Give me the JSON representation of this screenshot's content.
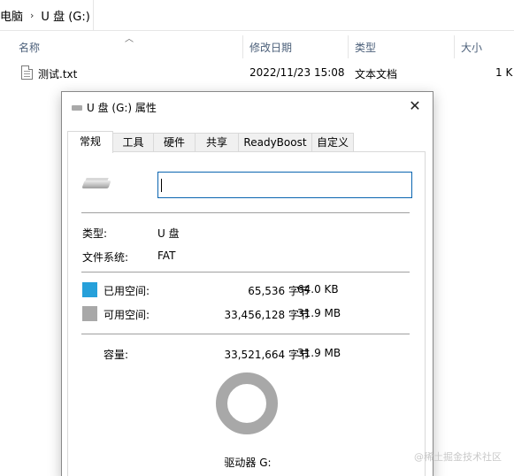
{
  "breadcrumb": {
    "pc": "电脑",
    "drive": "U 盘 (G:)",
    "separator": "›"
  },
  "columns": {
    "name": "名称",
    "modified": "修改日期",
    "type": "类型",
    "size": "大小"
  },
  "files": [
    {
      "name": "测试.txt",
      "modified": "2022/11/23 15:08",
      "type": "文本文档",
      "size": "1 K"
    }
  ],
  "dialog": {
    "title": "U 盘 (G:) 属性",
    "close_glyph": "✕",
    "tabs": [
      "常规",
      "工具",
      "硬件",
      "共享",
      "ReadyBoost",
      "自定义"
    ],
    "active_tab": "常规",
    "name_value": "",
    "type_label": "类型:",
    "type_value": "U 盘",
    "fs_label": "文件系统:",
    "fs_value": "FAT",
    "used_label": "已用空间:",
    "used_bytes": "65,536 字节",
    "used_size": "64.0 KB",
    "free_label": "可用空间:",
    "free_bytes": "33,456,128 字节",
    "free_size": "31.9 MB",
    "capacity_label": "容量:",
    "capacity_bytes": "33,521,664 字节",
    "capacity_size": "31.9 MB",
    "drive_label": "驱动器 G:",
    "used_color": "#26a0da",
    "free_color": "#a8a8a8"
  },
  "watermark": "@稀土掘金技术社区"
}
